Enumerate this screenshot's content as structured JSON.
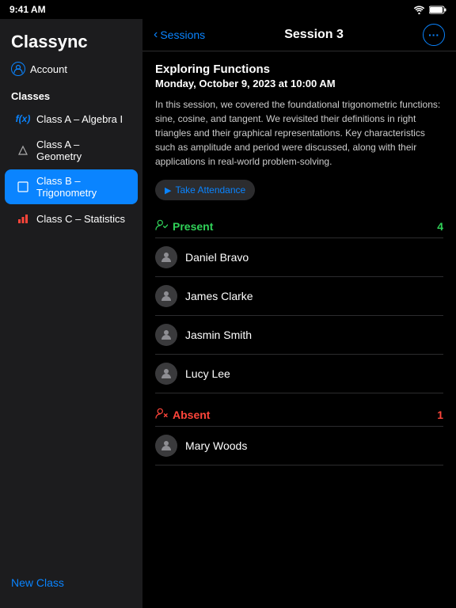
{
  "statusBar": {
    "time": "9:41 AM"
  },
  "sidebar": {
    "appTitle": "Classync",
    "account": {
      "label": "Account"
    },
    "sectionsLabel": "Classes",
    "items": [
      {
        "id": "algebra",
        "label": "Class A – Algebra I",
        "iconType": "fx",
        "active": false
      },
      {
        "id": "geometry",
        "label": "Class A – Geometry",
        "iconType": "geo",
        "active": false
      },
      {
        "id": "trigonometry",
        "label": "Class B – Trigonometry",
        "iconType": "trig",
        "active": true
      },
      {
        "id": "statistics",
        "label": "Class C – Statistics",
        "iconType": "stats",
        "active": false
      }
    ],
    "newClassLabel": "New Class"
  },
  "navBar": {
    "backLabel": "Sessions",
    "title": "Session 3"
  },
  "session": {
    "title": "Exploring Functions",
    "date": "Monday, October 9, 2023 at 10:00 AM",
    "description": "In this session, we covered the foundational trigonometric functions: sine, cosine, and tangent. We revisited their definitions in right triangles and their graphical representations. Key characteristics such as amplitude and period were discussed, along with their applications in real-world problem-solving.",
    "takeAttendanceLabel": "Take Attendance"
  },
  "attendance": {
    "presentLabel": "Present",
    "presentCount": "4",
    "absentLabel": "Absent",
    "absentCount": "1",
    "presentStudents": [
      {
        "name": "Daniel Bravo"
      },
      {
        "name": "James Clarke"
      },
      {
        "name": "Jasmin Smith"
      },
      {
        "name": "Lucy Lee"
      }
    ],
    "absentStudents": [
      {
        "name": "Mary Woods"
      }
    ]
  }
}
